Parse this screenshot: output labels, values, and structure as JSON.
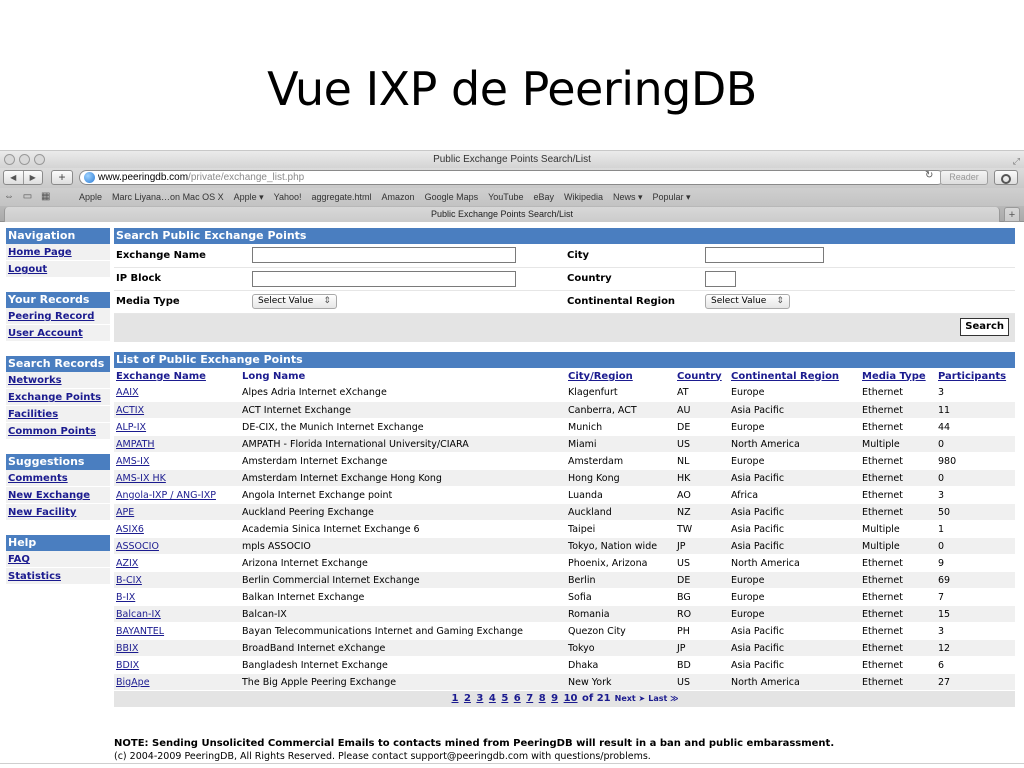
{
  "slide": {
    "title": "Vue IXP de PeeringDB"
  },
  "window": {
    "title": "Public Exchange Points Search/List",
    "url_host": "www.peeringdb.com",
    "url_path": "/private/exchange_list.php",
    "reader_label": "Reader",
    "tab_title": "Public Exchange Points Search/List"
  },
  "bookmarks": [
    "Apple",
    "Marc Liyana…on Mac OS X",
    "Apple ▾",
    "Yahoo!",
    "aggregate.html",
    "Amazon",
    "Google Maps",
    "YouTube",
    "eBay",
    "Wikipedia",
    "News ▾",
    "Popular ▾"
  ],
  "sidebar": {
    "sections": [
      {
        "title": "Navigation",
        "links": [
          "Home Page",
          "Logout"
        ]
      },
      {
        "title": "Your Records",
        "links": [
          "Peering Record",
          "User Account"
        ]
      },
      {
        "title": "Search Records",
        "links": [
          "Networks",
          "Exchange Points",
          "Facilities",
          "Common Points"
        ]
      },
      {
        "title": "Suggestions",
        "links": [
          "Comments",
          "New Exchange",
          "New Facility"
        ]
      },
      {
        "title": "Help",
        "links": [
          "FAQ",
          "Statistics"
        ]
      }
    ]
  },
  "search": {
    "title": "Search Public Exchange Points",
    "exchange_name_label": "Exchange Name",
    "city_label": "City",
    "ip_block_label": "IP Block",
    "country_label": "Country",
    "media_type_label": "Media Type",
    "media_type_value": "Select Value",
    "region_label": "Continental Region",
    "region_value": "Select Value",
    "button_label": "Search"
  },
  "list": {
    "title": "List of Public Exchange Points",
    "columns": [
      "Exchange Name",
      "Long Name",
      "City/Region",
      "Country",
      "Continental Region",
      "Media Type",
      "Participants"
    ],
    "rows": [
      [
        "AAIX",
        "Alpes Adria Internet eXchange",
        "Klagenfurt",
        "AT",
        "Europe",
        "Ethernet",
        "3"
      ],
      [
        "ACTIX",
        "ACT Internet Exchange",
        "Canberra, ACT",
        "AU",
        "Asia Pacific",
        "Ethernet",
        "11"
      ],
      [
        "ALP-IX",
        "DE-CIX, the Munich Internet Exchange",
        "Munich",
        "DE",
        "Europe",
        "Ethernet",
        "44"
      ],
      [
        "AMPATH",
        "AMPATH - Florida International University/CIARA",
        "Miami",
        "US",
        "North America",
        "Multiple",
        "0"
      ],
      [
        "AMS-IX",
        "Amsterdam Internet Exchange",
        "Amsterdam",
        "NL",
        "Europe",
        "Ethernet",
        "980"
      ],
      [
        "AMS-IX HK",
        "Amsterdam Internet Exchange Hong Kong",
        "Hong Kong",
        "HK",
        "Asia Pacific",
        "Ethernet",
        "0"
      ],
      [
        "Angola-IXP / ANG-IXP",
        "Angola Internet Exchange point",
        "Luanda",
        "AO",
        "Africa",
        "Ethernet",
        "3"
      ],
      [
        "APE",
        "Auckland Peering Exchange",
        "Auckland",
        "NZ",
        "Asia Pacific",
        "Ethernet",
        "50"
      ],
      [
        "ASIX6",
        "Academia Sinica Internet Exchange 6",
        "Taipei",
        "TW",
        "Asia Pacific",
        "Multiple",
        "1"
      ],
      [
        "ASSOCIO",
        "mpls ASSOCIO",
        "Tokyo, Nation wide",
        "JP",
        "Asia Pacific",
        "Multiple",
        "0"
      ],
      [
        "AZIX",
        "Arizona Internet Exchange",
        "Phoenix, Arizona",
        "US",
        "North America",
        "Ethernet",
        "9"
      ],
      [
        "B-CIX",
        "Berlin Commercial Internet Exchange",
        "Berlin",
        "DE",
        "Europe",
        "Ethernet",
        "69"
      ],
      [
        "B-IX",
        "Balkan Internet Exchange",
        "Sofia",
        "BG",
        "Europe",
        "Ethernet",
        "7"
      ],
      [
        "Balcan-IX",
        "Balcan-IX",
        "Romania",
        "RO",
        "Europe",
        "Ethernet",
        "15"
      ],
      [
        "BAYANTEL",
        "Bayan Telecommunications Internet and Gaming Exchange",
        "Quezon City",
        "PH",
        "Asia Pacific",
        "Ethernet",
        "3"
      ],
      [
        "BBIX",
        "BroadBand Internet eXchange",
        "Tokyo",
        "JP",
        "Asia Pacific",
        "Ethernet",
        "12"
      ],
      [
        "BDIX",
        "Bangladesh Internet Exchange",
        "Dhaka",
        "BD",
        "Asia Pacific",
        "Ethernet",
        "6"
      ],
      [
        "BigApe",
        "The Big Apple Peering Exchange",
        "New York",
        "US",
        "North America",
        "Ethernet",
        "27"
      ]
    ],
    "pages": [
      "1",
      "2",
      "3",
      "4",
      "5",
      "6",
      "7",
      "8",
      "9",
      "10"
    ],
    "of_label": "of 21",
    "next_label": "Next ➤",
    "last_label": "Last ≫"
  },
  "footer": {
    "note": "NOTE: Sending Unsolicited Commercial Emails to contacts mined from PeeringDB will result in a ban and public embarassment.",
    "copyright": "(c) 2004-2009 PeeringDB, All Rights Reserved. Please contact support@peeringdb.com with questions/problems."
  }
}
